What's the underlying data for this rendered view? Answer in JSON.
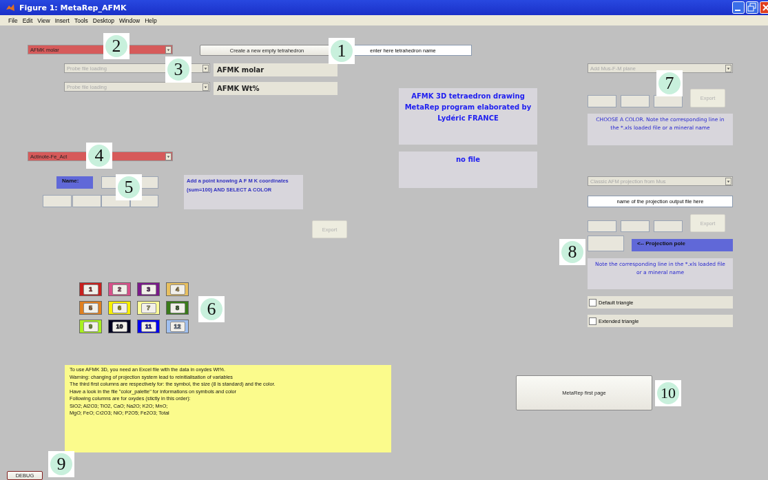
{
  "window": {
    "title": "Figure 1: MetaRep_AFMK"
  },
  "menu": [
    "File",
    "Edit",
    "View",
    "Insert",
    "Tools",
    "Desktop",
    "Window",
    "Help"
  ],
  "dropdowns": [
    {
      "value": "AFMK molar",
      "disabled": false
    },
    {
      "value": "Probe file loading",
      "disabled": true
    },
    {
      "value": "Probe file loading",
      "disabled": true
    },
    {
      "value": "Add Mus-F-M plane",
      "disabled": true
    },
    {
      "value": "Actinote-Fe_Act",
      "disabled": false
    },
    {
      "value": "Classic AFM projection from Mus",
      "disabled": true
    }
  ],
  "buttons": [
    {
      "label": "Create a new empty tetrahedron",
      "disabled": false
    },
    {
      "label": "Export",
      "disabled": true
    },
    {
      "label": "Export",
      "disabled": true
    },
    {
      "label": "Export",
      "disabled": true
    },
    {
      "label": "MetaRep first page",
      "disabled": false
    },
    {
      "label": "DEBUG",
      "disabled": false
    }
  ],
  "text_fields": [
    {
      "value": "enter here tetrahedron name"
    },
    {
      "value": "name of the projection output file here"
    }
  ],
  "labels": [
    {
      "text": "AFMK molar",
      "kind": "file"
    },
    {
      "text": "AFMK Wt%",
      "kind": "file"
    },
    {
      "text": "Name:",
      "kind": "tag"
    },
    {
      "text": "<-- Projection pole",
      "kind": "tag"
    }
  ],
  "info_boxes": [
    {
      "kind": "title",
      "lines": [
        "AFMK 3D tetraedron drawing",
        "MetaRep program elaborated by",
        "Lydéric FRANCE"
      ]
    },
    {
      "kind": "title",
      "lines": [
        "no file"
      ]
    },
    {
      "kind": "note",
      "lines": [
        "CHOOSE A COLOR. Note the corresponding line in",
        "the *.xls loaded file or a mineral name"
      ]
    },
    {
      "kind": "point",
      "lines": [
        "Add a point knowing A F M K       coordinates",
        " (sum=100)           AND SELECT A COLOR"
      ]
    },
    {
      "kind": "note",
      "lines": [
        "Note the corresponding line in the *.xls loaded file",
        "or a mineral name"
      ]
    }
  ],
  "checkboxes": [
    {
      "label": "Default triangle",
      "checked": false
    },
    {
      "label": "Extended triangle",
      "checked": false
    }
  ],
  "color_buttons": [
    {
      "label": "1",
      "color": "#c8201e"
    },
    {
      "label": "2",
      "color": "#d8508a"
    },
    {
      "label": "3",
      "color": "#7a1a8a"
    },
    {
      "label": "4",
      "color": "#e8c060"
    },
    {
      "label": "5",
      "color": "#e08020"
    },
    {
      "label": "6",
      "color": "#f8f000"
    },
    {
      "label": "7",
      "color": "#ffff99"
    },
    {
      "label": "8",
      "color": "#3a7a1a"
    },
    {
      "label": "9",
      "color": "#a8f020"
    },
    {
      "label": "10",
      "color": "#000020"
    },
    {
      "label": "11",
      "color": "#0000f0"
    },
    {
      "label": "12",
      "color": "#a0c0f0"
    }
  ],
  "help_text": {
    "lines": [
      "To use AFMK 3D, you need an Excel file with the data in oxydes Wt%.",
      "Warning: changing of projection system lead to reinitialisation of variables",
      "The third first columns are respectively for: the symbol, the size (8 is standard) and the color.",
      "Have a look in the file \"color_palette\" for informations on symbols and color",
      "Following columns are for oxydes (stictly in this order):",
      "SiO2; Al2O3; TiO2, CaO; Na2O; K2O; MnO;",
      "MgO; FeO; Cr2O3; NiO; P2O5; Fe2O3; Total"
    ]
  },
  "callouts": [
    "1",
    "2",
    "3",
    "4",
    "5",
    "6",
    "7",
    "8",
    "9",
    "10"
  ]
}
